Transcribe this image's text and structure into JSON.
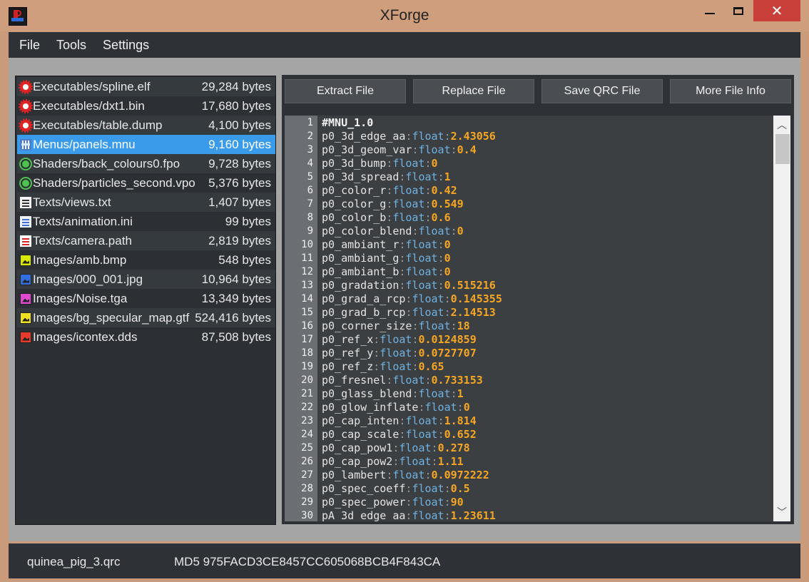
{
  "window": {
    "title": "XForge",
    "close_glyph": "✕"
  },
  "menu": [
    "File",
    "Tools",
    "Settings"
  ],
  "files": [
    {
      "name": "Executables/spline.elf",
      "size": "29,284 bytes",
      "icon": "executable-icon"
    },
    {
      "name": "Executables/dxt1.bin",
      "size": "17,680 bytes",
      "icon": "executable-icon"
    },
    {
      "name": "Executables/table.dump",
      "size": "4,100 bytes",
      "icon": "executable-icon"
    },
    {
      "name": "Menus/panels.mnu",
      "size": "9,160 bytes",
      "icon": "menu-file-icon",
      "selected": true
    },
    {
      "name": "Shaders/back_colours0.fpo",
      "size": "9,728 bytes",
      "icon": "shader-icon"
    },
    {
      "name": "Shaders/particles_second.vpo",
      "size": "5,376 bytes",
      "icon": "shader-icon"
    },
    {
      "name": "Texts/views.txt",
      "size": "1,407 bytes",
      "icon": "text-file-icon"
    },
    {
      "name": "Texts/animation.ini",
      "size": "99 bytes",
      "icon": "ini-file-icon"
    },
    {
      "name": "Texts/camera.path",
      "size": "2,819 bytes",
      "icon": "path-file-icon"
    },
    {
      "name": "Images/amb.bmp",
      "size": "548 bytes",
      "icon": "image-icon",
      "color": "#d8e800"
    },
    {
      "name": "Images/000_001.jpg",
      "size": "10,964 bytes",
      "icon": "image-icon",
      "color": "#2f6fe0"
    },
    {
      "name": "Images/Noise.tga",
      "size": "13,349 bytes",
      "icon": "image-icon",
      "color": "#e04ad0"
    },
    {
      "name": "Images/bg_specular_map.gtf",
      "size": "524,416 bytes",
      "icon": "image-icon",
      "color": "#f0e020"
    },
    {
      "name": "Images/icontex.dds",
      "size": "87,508 bytes",
      "icon": "image-icon",
      "color": "#e83a2a"
    }
  ],
  "buttons": {
    "extract": "Extract File",
    "replace": "Replace File",
    "save_qrc": "Save QRC File",
    "more_info": "More File Info"
  },
  "editor": {
    "header": "#MNU_1.0",
    "lines": [
      {
        "k": "p0_3d_edge_aa",
        "t": "float",
        "v": "2.43056"
      },
      {
        "k": "p0_3d_geom_var",
        "t": "float",
        "v": "0.4"
      },
      {
        "k": "p0_3d_bump",
        "t": "float",
        "v": "0"
      },
      {
        "k": "p0_3d_spread",
        "t": "float",
        "v": "1"
      },
      {
        "k": "p0_color_r",
        "t": "float",
        "v": "0.42"
      },
      {
        "k": "p0_color_g",
        "t": "float",
        "v": "0.549"
      },
      {
        "k": "p0_color_b",
        "t": "float",
        "v": "0.6"
      },
      {
        "k": "p0_color_blend",
        "t": "float",
        "v": "0"
      },
      {
        "k": "p0_ambiant_r",
        "t": "float",
        "v": "0"
      },
      {
        "k": "p0_ambiant_g",
        "t": "float",
        "v": "0"
      },
      {
        "k": "p0_ambiant_b",
        "t": "float",
        "v": "0"
      },
      {
        "k": "p0_gradation",
        "t": "float",
        "v": "0.515216"
      },
      {
        "k": "p0_grad_a_rcp",
        "t": "float",
        "v": "0.145355"
      },
      {
        "k": "p0_grad_b_rcp",
        "t": "float",
        "v": "2.14513"
      },
      {
        "k": "p0_corner_size",
        "t": "float",
        "v": "18"
      },
      {
        "k": "p0_ref_x",
        "t": "float",
        "v": "0.0124859"
      },
      {
        "k": "p0_ref_y",
        "t": "float",
        "v": "0.0727707"
      },
      {
        "k": "p0_ref_z",
        "t": "float",
        "v": "0.65"
      },
      {
        "k": "p0_fresnel",
        "t": "float",
        "v": "0.733153"
      },
      {
        "k": "p0_glass_blend",
        "t": "float",
        "v": "1"
      },
      {
        "k": "p0_glow_inflate",
        "t": "float",
        "v": "0"
      },
      {
        "k": "p0_cap_inten",
        "t": "float",
        "v": "1.814"
      },
      {
        "k": "p0_cap_scale",
        "t": "float",
        "v": "0.652"
      },
      {
        "k": "p0_cap_pow1",
        "t": "float",
        "v": "0.278"
      },
      {
        "k": "p0_cap_pow2",
        "t": "float",
        "v": "1.11"
      },
      {
        "k": "p0_lambert",
        "t": "float",
        "v": "0.0972222"
      },
      {
        "k": "p0_spec_coeff",
        "t": "float",
        "v": "0.5"
      },
      {
        "k": "p0_spec_power",
        "t": "float",
        "v": "90"
      },
      {
        "k": "pA_3d_edge_aa",
        "t": "float",
        "v": "1.23611"
      }
    ]
  },
  "status": {
    "file": "quinea_pig_3.qrc",
    "md5": "MD5 975FACD3CE8457CC605068BCB4F843CA"
  }
}
